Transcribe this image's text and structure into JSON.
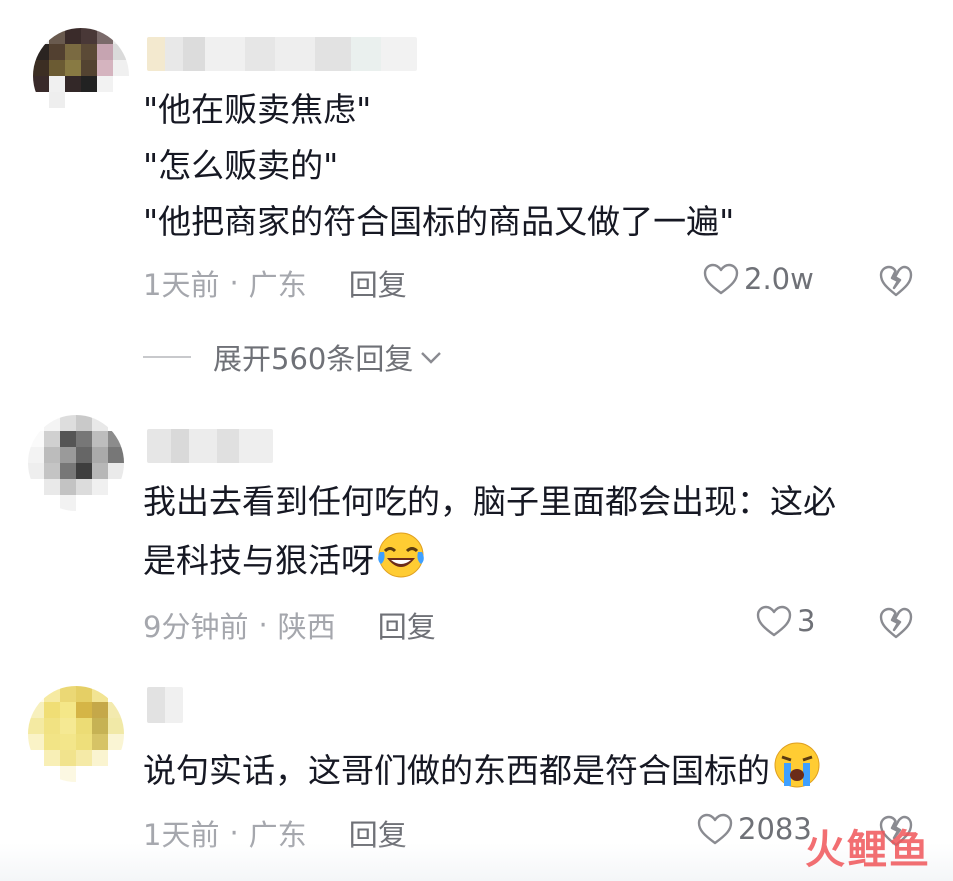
{
  "comments": [
    {
      "lines": [
        "\"他在贩卖焦虑\"",
        "\"怎么贩卖的\"",
        "\"他把商家的符合国标的商品又做了一遍\""
      ],
      "time": "1天前",
      "location": "广东",
      "reply_label": "回复",
      "likes": "2.0w",
      "expand_label": "展开560条回复"
    },
    {
      "lines": [
        "我出去看到任何吃的，脑子里面都会出现：这必",
        "是科技与狠活呀"
      ],
      "emoji": "laughing-crying-emoji",
      "time": "9分钟前",
      "location": "陕西",
      "reply_label": "回复",
      "likes": "3"
    },
    {
      "lines": [
        "说句实话，这哥们做的东西都是符合国标的"
      ],
      "emoji": "crying-emoji",
      "time": "1天前",
      "location": "广东",
      "reply_label": "回复",
      "likes": "2083"
    }
  ],
  "separator": "·",
  "watermark": "火鲤鱼",
  "colors": {
    "text": "#161823",
    "meta": "#a5a7ad",
    "action": "#6f7177",
    "watermark": "#f0565a"
  }
}
